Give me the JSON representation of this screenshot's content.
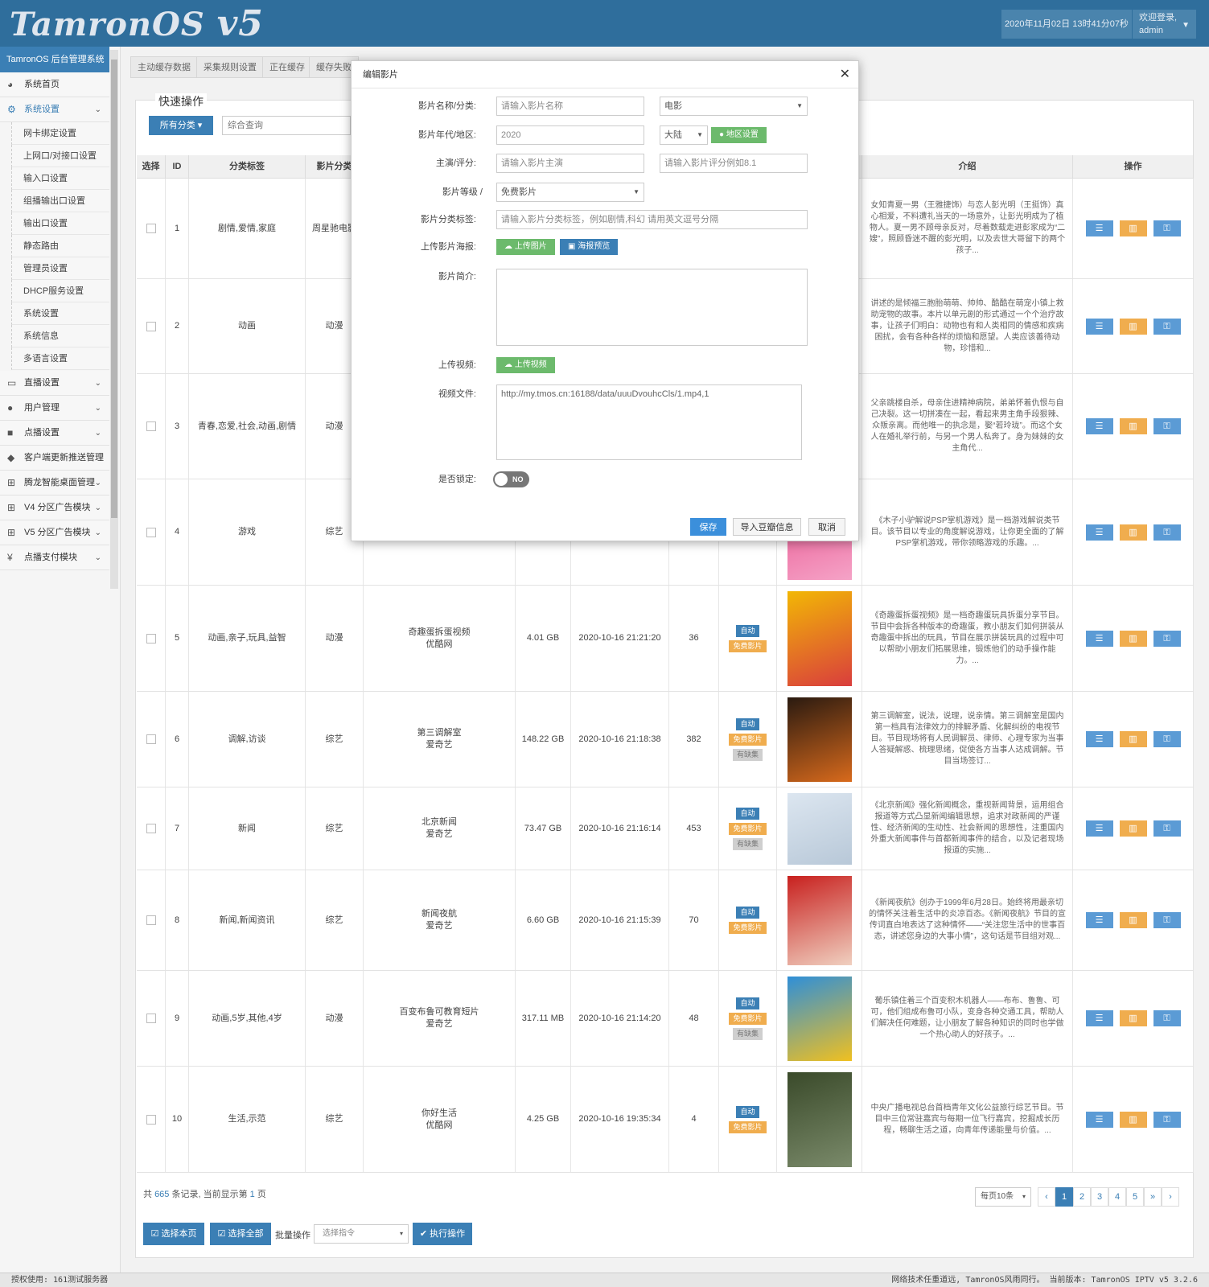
{
  "header": {
    "logo": "TamronOS",
    "logo_version": "v5",
    "datetime": "2020年11月02日 13时41分07秒",
    "welcome": "欢迎登录,",
    "username": "admin"
  },
  "sidebar": {
    "title": "TamronOS 后台管理系统",
    "items": [
      {
        "label": "系统首页",
        "icon": "dashboard-icon"
      },
      {
        "label": "系统设置",
        "icon": "gears-icon"
      },
      {
        "label": "直播设置",
        "icon": "monitor-icon"
      },
      {
        "label": "用户管理",
        "icon": "user-icon"
      },
      {
        "label": "点播设置",
        "icon": "video-camera-icon"
      },
      {
        "label": "客户端更新推送管理",
        "icon": "android-icon"
      },
      {
        "label": "腾龙智能桌面管理",
        "icon": "windows-icon"
      },
      {
        "label": "V4 分区广告模块",
        "icon": "windows-icon"
      },
      {
        "label": "V5 分区广告模块",
        "icon": "windows-icon"
      },
      {
        "label": "点播支付模块",
        "icon": "yen-icon"
      }
    ],
    "subitems": [
      "网卡绑定设置",
      "上网口/对接口设置",
      "输入口设置",
      "组播输出口设置",
      "输出口设置",
      "静态路由",
      "管理员设置",
      "DHCP服务设置",
      "系统设置",
      "系统信息",
      "多语言设置"
    ]
  },
  "tabs": [
    "主动缓存数据",
    "采集规则设置",
    "正在缓存",
    "缓存失败"
  ],
  "quick": {
    "title": "快速操作",
    "category_btn": "所有分类",
    "search_placeholder": "综合查询"
  },
  "table": {
    "headers": [
      "选择",
      "ID",
      "分类标签",
      "影片分类",
      "介绍",
      "操作"
    ],
    "rows": [
      {
        "id": "1",
        "tags": "剧情,爱情,家庭",
        "cat": "周星驰电影",
        "name": "",
        "size": "",
        "time": "",
        "count": "",
        "badges": [],
        "desc": "女知青夏一男（王雅捷饰）与恋人彭光明（王挺饰）真心相爱，不料遭礼当天的一场意外，让彭光明成为了植物人。夏一男不顾母亲反对，尽着数载走进彭家成为“二嫂”，照顾昏迷不醒的彭光明，以及去世大哥留下的两个孩子..."
      },
      {
        "id": "2",
        "tags": "动画",
        "cat": "动漫",
        "name": "",
        "size": "",
        "time": "",
        "count": "",
        "badges": [],
        "desc": "讲述的是倾福三胞胎萌萌、帅帅、酷酷在萌宠小镇上救助宠物的故事。本片以单元剧的形式通过一个个治疗故事，让孩子们明白：动物也有和人类相同的情感和疾病困扰，会有各种各样的烦恼和愿望。人类应该善待动物，珍惜和..."
      },
      {
        "id": "3",
        "tags": "青春,恋爱,社会,动画,剧情",
        "cat": "动漫",
        "name": "",
        "size": "",
        "time": "",
        "count": "",
        "badges": [],
        "desc": "父亲跳楼自杀，母亲住进精神病院，弟弟怀着仇恨与自己决裂。这一切拼凑在一起，看起来男主角手段狠辣、众叛亲离。而他唯一的执念是，娶“若玲珑”。而这个女人在婚礼举行前，与另一个男人私奔了。身为妹妹的女主角代..."
      },
      {
        "id": "4",
        "tags": "游戏",
        "cat": "综艺",
        "name": "",
        "size": "",
        "time": "",
        "count": "",
        "badges": [],
        "desc": "《木子小驴解说PSP掌机游戏》是一档游戏解说类节目。该节目以专业的角度解说游戏，让你更全面的了解PSP掌机游戏，带你领略游戏的乐趣。..."
      },
      {
        "id": "5",
        "tags": "动画,亲子,玩具,益智",
        "cat": "动漫",
        "name": "奇趣蛋拆蛋视频\n优酷网",
        "size": "4.01 GB",
        "time": "2020-10-16 21:21:20",
        "count": "36",
        "badges": [
          "自动",
          "免费影片"
        ],
        "desc": "《奇趣蛋拆蛋视频》是一档奇趣蛋玩具拆蛋分享节目。节目中会拆各种版本的奇趣蛋，教小朋友们如何拼装从奇趣蛋中拆出的玩具，节目在展示拼装玩具的过程中可以帮助小朋友们拓展思维，锻炼他们的动手操作能力。..."
      },
      {
        "id": "6",
        "tags": "调解,访谈",
        "cat": "综艺",
        "name": "第三调解室\n爱奇艺",
        "size": "148.22 GB",
        "time": "2020-10-16 21:18:38",
        "count": "382",
        "badges": [
          "自动",
          "免费影片",
          "有缺集"
        ],
        "desc": "第三调解室，说法，说理，说亲情。第三调解室是国内第一档具有法律效力的排解矛盾、化解纠纷的电视节目。节目现场将有人民调解员、律师、心理专家为当事人答疑解惑、梳理思绪，促使各方当事人达成调解。节目当场签订..."
      },
      {
        "id": "7",
        "tags": "新闻",
        "cat": "综艺",
        "name": "北京新闻\n爱奇艺",
        "size": "73.47 GB",
        "time": "2020-10-16 21:16:14",
        "count": "453",
        "badges": [
          "自动",
          "免费影片",
          "有缺集"
        ],
        "desc": "《北京新闻》强化新闻概念，重视新闻背景，运用组合报道等方式凸显新闻编辑思想，追求对政新闻的严谨性、经济新闻的生动性、社会新闻的思想性，注重国内外重大新闻事件与首都新闻事件的结合，以及记者现场报道的实施..."
      },
      {
        "id": "8",
        "tags": "新闻,新闻资讯",
        "cat": "综艺",
        "name": "新闻夜航\n爱奇艺",
        "size": "6.60 GB",
        "time": "2020-10-16 21:15:39",
        "count": "70",
        "badges": [
          "自动",
          "免费影片"
        ],
        "desc": "《新闻夜航》创办于1999年6月28日。始终将用最亲切的情怀关注着生活中的炎凉百态。《新闻夜航》节目的宣传词直白地表达了这种情怀——“关注您生活中的世事百态，讲述您身边的大事小情”，这句话是节目组对观..."
      },
      {
        "id": "9",
        "tags": "动画,5岁,其他,4岁",
        "cat": "动漫",
        "name": "百变布鲁可教育短片\n爱奇艺",
        "size": "317.11 MB",
        "time": "2020-10-16 21:14:20",
        "count": "48",
        "badges": [
          "自动",
          "免费影片",
          "有缺集"
        ],
        "desc": "葡乐镇住着三个百变积木机器人——布布、鲁鲁、可可，他们组成布鲁可小队，变身各种交通工具，帮助人们解决任何难题，让小朋友了解各种知识的同时也学做一个热心助人的好孩子。..."
      },
      {
        "id": "10",
        "tags": "生活,示范",
        "cat": "综艺",
        "name": "你好生活\n优酷网",
        "size": "4.25 GB",
        "time": "2020-10-16 19:35:34",
        "count": "4",
        "badges": [
          "自动",
          "免费影片"
        ],
        "desc": "中央广播电视总台首档青年文化公益旅行综艺节目。节目中三位常驻嘉宾与每期一位飞行嘉宾，挖掘成长历程，畅聊生活之道，向青年传递能量与价值。..."
      }
    ]
  },
  "footer": {
    "total_prefix": "共",
    "total_count": "665",
    "total_mid": "条记录, 当前显示第",
    "page_num": "1",
    "total_suffix": "页",
    "per_page": "每页10条",
    "pages": [
      "‹",
      "1",
      "2",
      "3",
      "4",
      "5",
      "»",
      "›"
    ],
    "select_page": "选择本页",
    "select_all": "选择全部",
    "batch_label": "批量操作",
    "batch_placeholder": "选择指令",
    "execute": "执行操作"
  },
  "statusbar": {
    "left": "授权使用: 161测试服务器",
    "right": "网络技术任重道远, TamronOS风雨同行。 当前版本: TamronOS IPTV v5 3.2.6"
  },
  "modal": {
    "title": "编辑影片",
    "labels": {
      "name_cat": "影片名称/分类:",
      "year_region": "影片年代/地区:",
      "actor_score": "主演/评分:",
      "level": "影片等级 /",
      "tags": "影片分类标签:",
      "poster": "上传影片海报:",
      "intro": "影片简介:",
      "video": "上传视频:",
      "video_file": "视频文件:",
      "locked": "是否锁定:"
    },
    "name_placeholder": "请输入影片名称",
    "category_value": "电影",
    "year_value": "2020",
    "region_value": "大陆",
    "region_btn": "地区设置",
    "actor_placeholder": "请输入影片主演",
    "score_placeholder": "请输入影片评分例如8.1",
    "level_value": "免费影片",
    "tags_placeholder": "请输入影片分类标签，例如剧情,科幻 请用英文逗号分隔",
    "upload_image": "上传图片",
    "poster_preview": "海报预览",
    "upload_video": "上传视频",
    "video_file_value": "http://my.tmos.cn:16188/data/uuuDvouhcCls/1.mp4,1",
    "toggle_label": "NO",
    "save": "保存",
    "import": "导入豆瓣信息",
    "cancel": "取消"
  }
}
